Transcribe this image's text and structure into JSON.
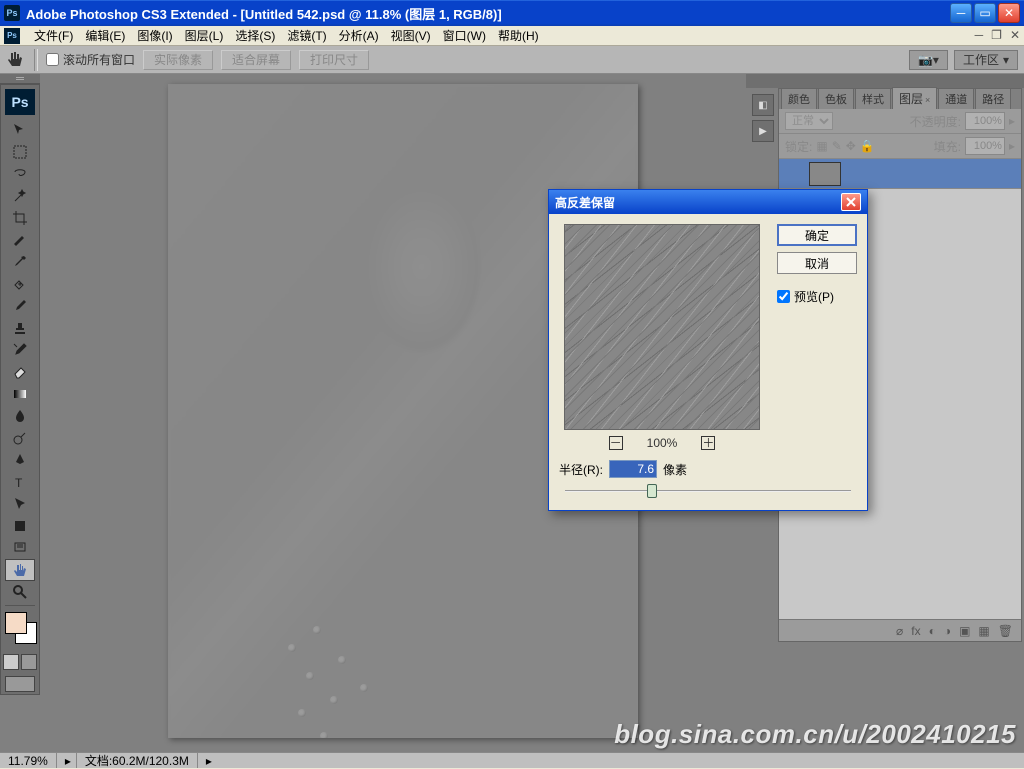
{
  "titlebar": {
    "app_icon": "Ps",
    "title": "Adobe Photoshop CS3 Extended - [Untitled 542.psd @ 11.8% (图层 1, RGB/8)]"
  },
  "menubar": {
    "items": [
      "文件(F)",
      "编辑(E)",
      "图像(I)",
      "图层(L)",
      "选择(S)",
      "滤镜(T)",
      "分析(A)",
      "视图(V)",
      "窗口(W)",
      "帮助(H)"
    ]
  },
  "optionsbar": {
    "scroll_all": "滚动所有窗口",
    "btn_actual": "实际像素",
    "btn_fit": "适合屏幕",
    "btn_print": "打印尺寸",
    "workspace": "工作区"
  },
  "toolbox": {
    "logo": "Ps",
    "tools": [
      "move",
      "marquee",
      "lasso",
      "wand",
      "crop",
      "slice",
      "eyedrop",
      "heal",
      "brush",
      "stamp",
      "history",
      "eraser",
      "gradient",
      "blur",
      "dodge",
      "pen",
      "type",
      "path",
      "shape",
      "notes",
      "hand",
      "zoom"
    ],
    "active_tool": "hand",
    "fg_color": "#f6dbc6",
    "bg_color": "#ffffff"
  },
  "panels": {
    "tabs": [
      "颜色",
      "色板",
      "样式",
      "图层",
      "通道",
      "路径"
    ],
    "active_tab": "图层",
    "blend_label": "正常",
    "opacity_label": "不透明度:",
    "opacity_value": "100%",
    "lock_label": "锁定:",
    "fill_label": "填充:",
    "fill_value": "100%"
  },
  "dialog": {
    "title": "高反差保留",
    "ok": "确定",
    "cancel": "取消",
    "preview_label": "预览(P)",
    "preview_checked": true,
    "zoom_value": "100%",
    "radius_label": "半径(R):",
    "radius_value": "7.6",
    "radius_unit": "像素"
  },
  "statusbar": {
    "zoom": "11.79%",
    "doc": "文档:60.2M/120.3M"
  },
  "watermark": "blog.sina.com.cn/u/2002410215"
}
